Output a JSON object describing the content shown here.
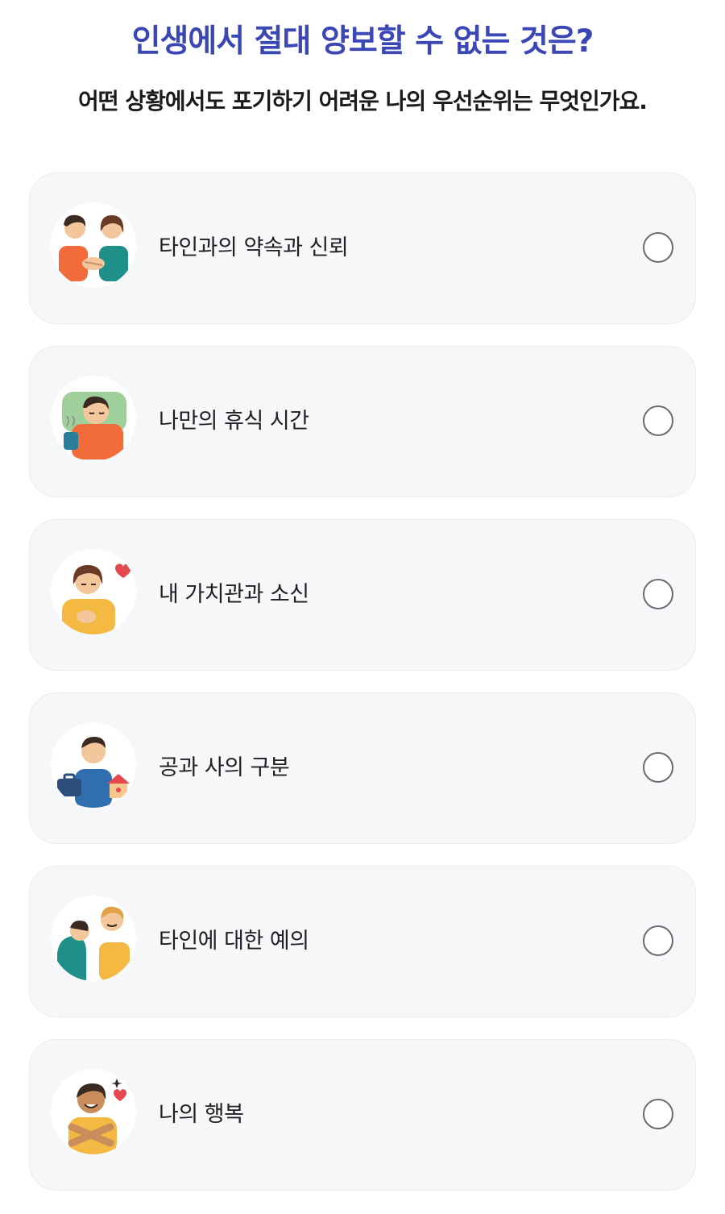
{
  "question": {
    "title": "인생에서 절대 양보할 수 없는 것은?",
    "subtitle": "어떤 상황에서도 포기하기 어려운 나의 우선순위는 무엇인가요."
  },
  "options": [
    {
      "label": "타인과의 약속과 신뢰",
      "icon": "handshake-icon",
      "selected": false
    },
    {
      "label": "나만의 휴식 시간",
      "icon": "resting-person-icon",
      "selected": false
    },
    {
      "label": "내 가치관과 소신",
      "icon": "hand-on-heart-icon",
      "selected": false
    },
    {
      "label": "공과 사의 구분",
      "icon": "work-home-balance-icon",
      "selected": false
    },
    {
      "label": "타인에 대한 예의",
      "icon": "bowing-people-icon",
      "selected": false
    },
    {
      "label": "나의 행복",
      "icon": "self-hug-icon",
      "selected": false
    }
  ],
  "colors": {
    "title": "#3b47b4",
    "card_bg": "#f6f7f9",
    "radio_border": "#6a6a70"
  }
}
